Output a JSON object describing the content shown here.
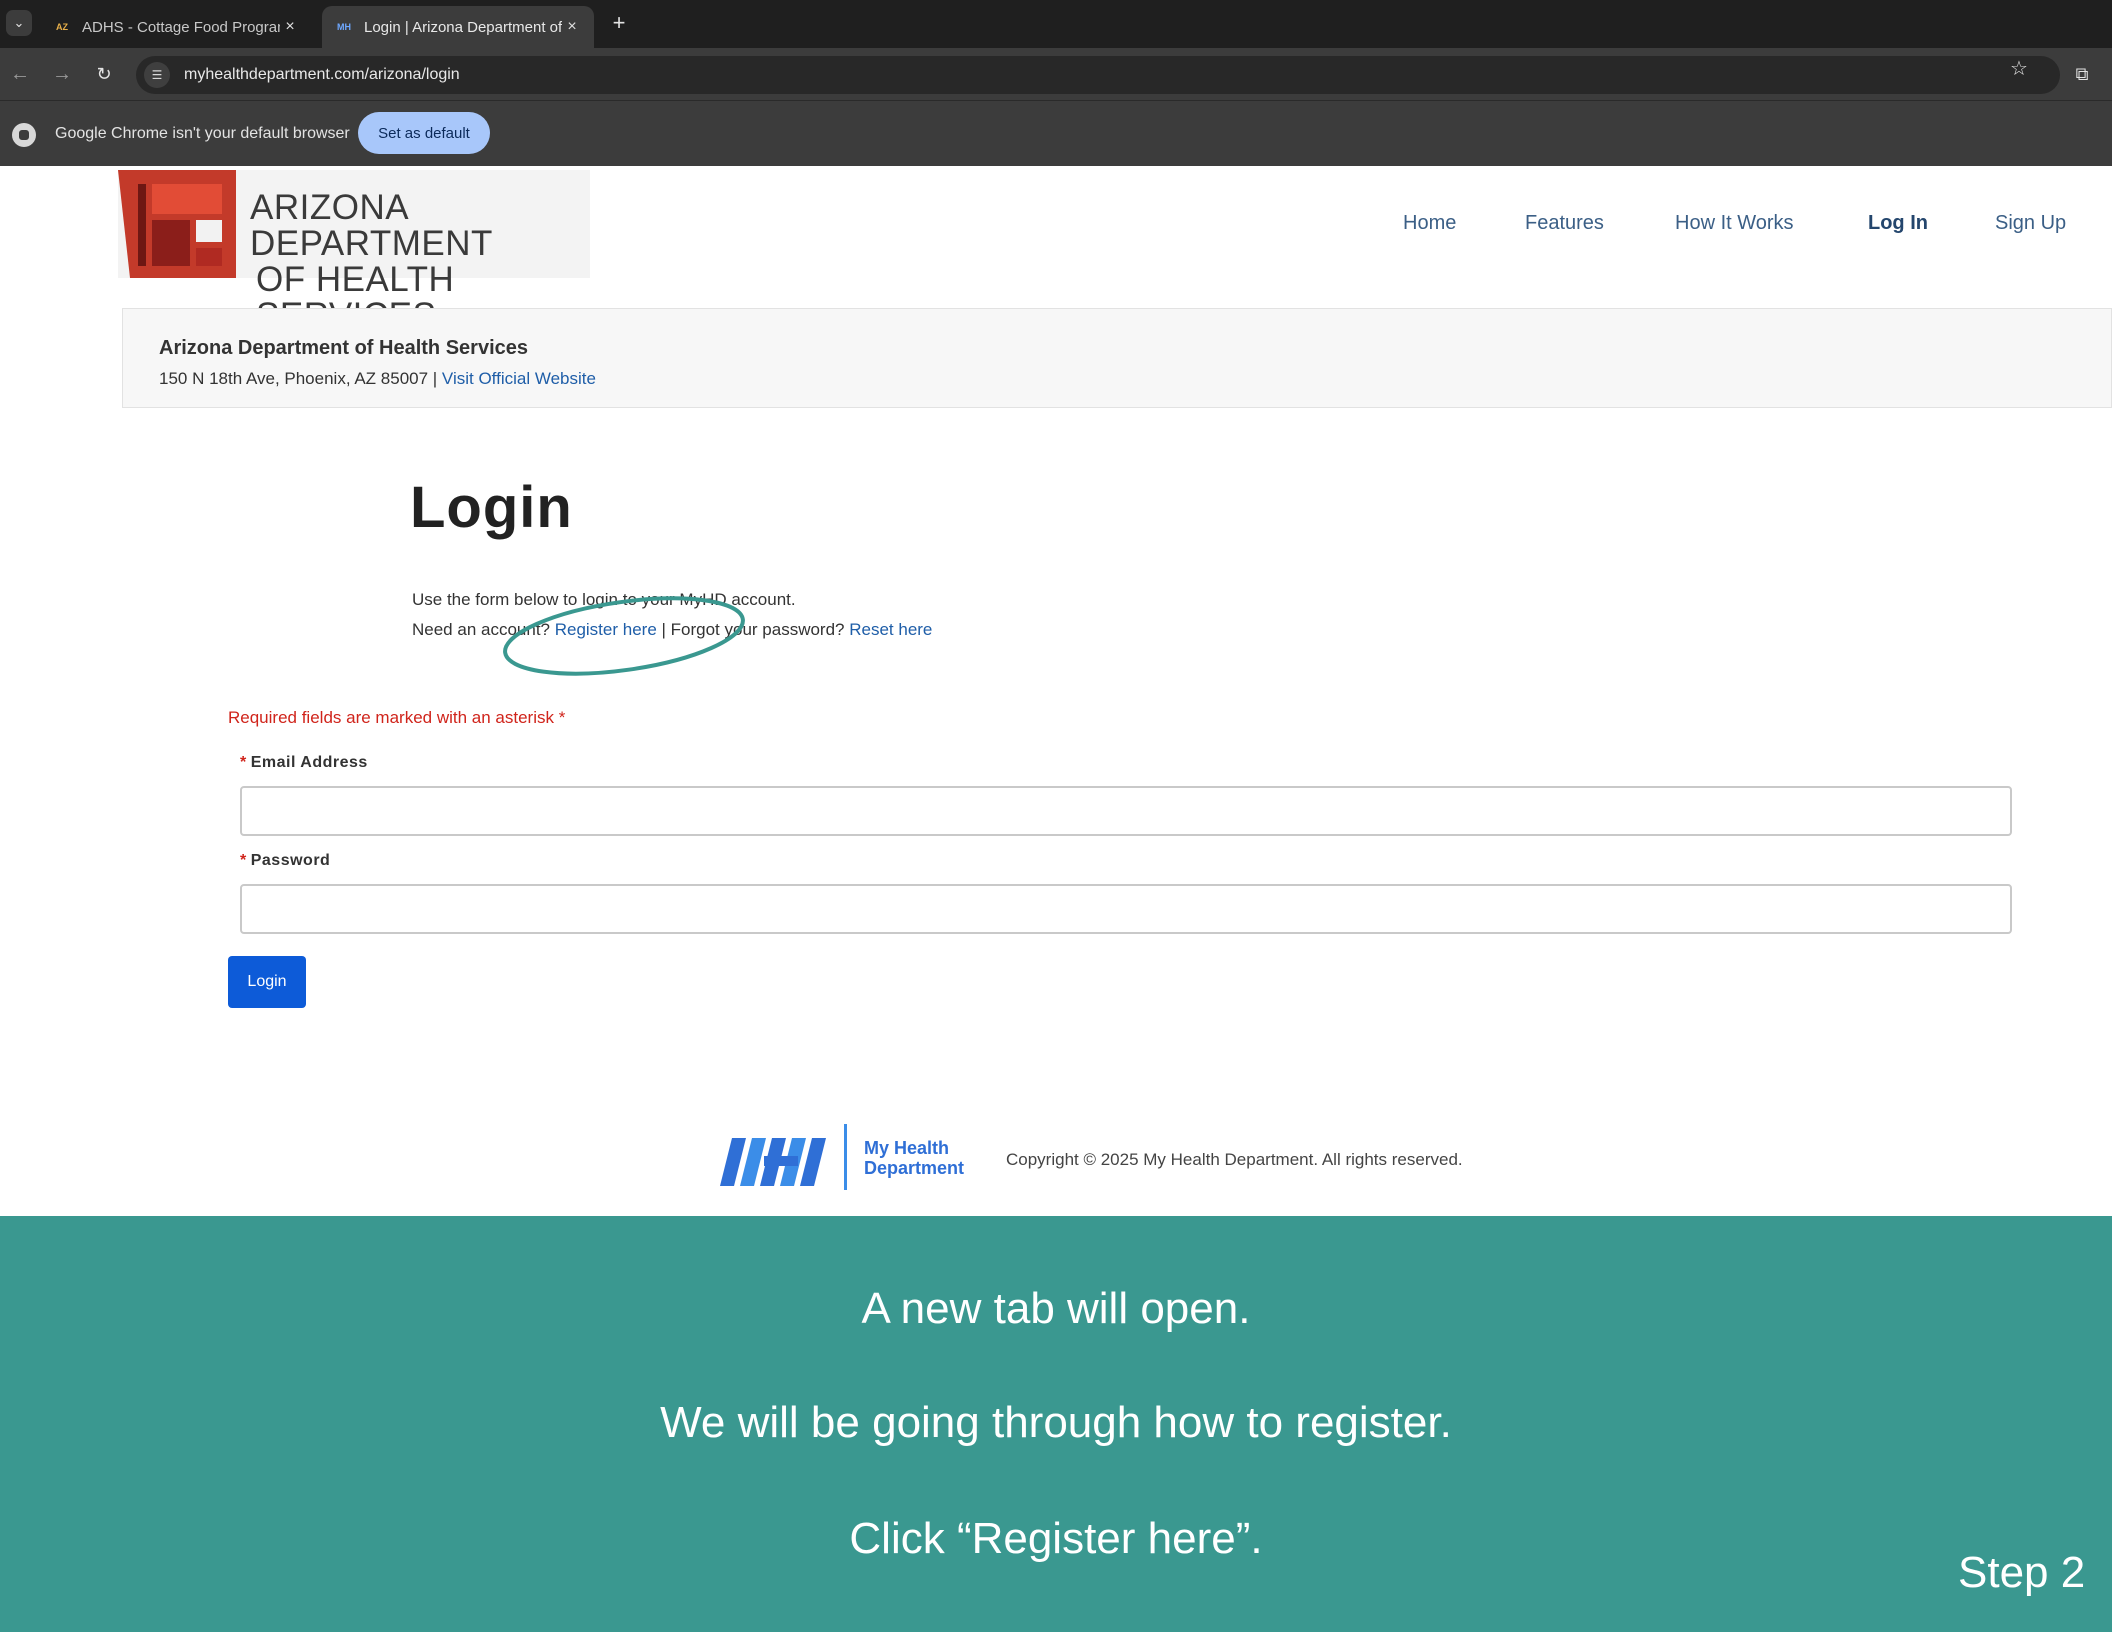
{
  "browser": {
    "tabs": [
      {
        "favicon": "AZ",
        "title": "ADHS - Cottage Food Program",
        "close": "×"
      },
      {
        "favicon": "MH",
        "title": "Login | Arizona Department of Health Services",
        "close": "×"
      }
    ],
    "new_tab": "+",
    "url": "myhealthdepartment.com/arizona/login",
    "infobar_text": "Google Chrome isn't your default browser",
    "set_default_label": "Set as default"
  },
  "site": {
    "logo_line1": "ARIZONA DEPARTMENT",
    "logo_line2": "OF HEALTH SERVICES",
    "nav": [
      {
        "label": "Home"
      },
      {
        "label": "Features"
      },
      {
        "label": "How It Works"
      },
      {
        "label": "Log In",
        "current": true
      },
      {
        "label": "Sign Up"
      }
    ],
    "dept_name": "Arizona Department of Health Services",
    "dept_address": "150 N 18th Ave, Phoenix, AZ 85007 | ",
    "dept_website_link": "Visit Official Website"
  },
  "login": {
    "title": "Login",
    "help_line1": "Use the form below to login to your MyHD account.",
    "need_account": "Need an account? ",
    "register_link": "Register here",
    "forgot_text": " | Forgot your password? ",
    "reset_link": "Reset here",
    "required_note": "Required fields are marked with an asterisk",
    "asterisk": "*",
    "email_label": "Email Address",
    "email_value": "",
    "password_label": "Password",
    "password_value": "",
    "submit_label": "Login"
  },
  "footer": {
    "brand_line1": "My Health",
    "brand_line2": "Department",
    "copyright": "Copyright © 2025 My Health Department. All rights reserved."
  },
  "instructions": {
    "line1": "A new tab will open.",
    "line2": "We will be going through how to register.",
    "line3": "Click “Register here”.",
    "step": "Step 2"
  },
  "colors": {
    "banner": "#3a9890",
    "annotation": "#3a9890",
    "link": "#1f5ea8",
    "button": "#0d5bd8",
    "required": "#d0241b"
  },
  "icons": {
    "tab_menu": "chevron-down-icon",
    "back": "arrow-left-icon",
    "forward": "arrow-right-icon",
    "reload": "reload-icon",
    "site_info": "tune-icon",
    "bookmark": "star-icon",
    "extensions": "puzzle-icon",
    "chrome": "chrome-logo-icon"
  }
}
